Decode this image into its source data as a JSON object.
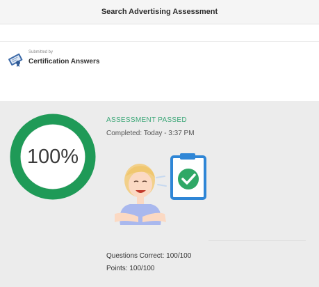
{
  "header": {
    "title": "Search Advertising Assessment"
  },
  "submission": {
    "submitted_by_label": "Submitted by",
    "name": "Certification Answers",
    "icon": "certificate-icon"
  },
  "result": {
    "score": "100%",
    "score_fraction": 1.0,
    "status": "ASSESSMENT PASSED",
    "completed": "Completed: Today - 3:37 PM",
    "questions": "Questions Correct: 100/100",
    "points": "Points: 100/100",
    "illustration": "celebrating-person-with-checkmark-clipboard"
  },
  "colors": {
    "ring": "#1f9a57",
    "status": "#3aa676",
    "clipboard": "#2f86d6",
    "check": "#2fa866"
  }
}
